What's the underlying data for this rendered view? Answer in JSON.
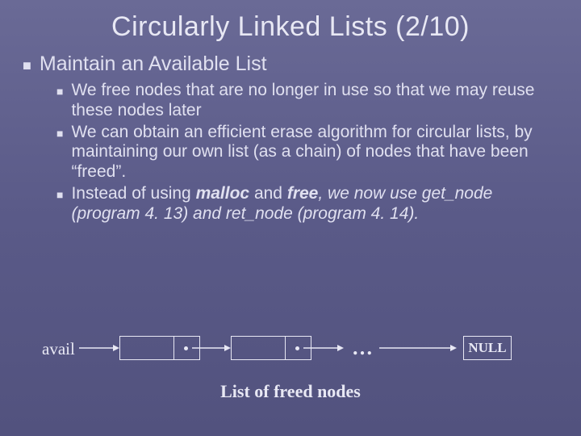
{
  "title": "Circularly Linked Lists (2/10)",
  "heading": "Maintain an Available List",
  "bullets": [
    "We free nodes that are no longer in use so that we may reuse these nodes later",
    "We can obtain an efficient erase algorithm for circular lists, by maintaining our own list (as a chain) of nodes that have been “freed”.",
    {
      "pre": "Instead of using ",
      "m": "malloc",
      "mid": " and ",
      "f": "free",
      "post": ", we now use get_node (program 4. 13) and ret_node (program 4. 14)."
    }
  ],
  "diagram": {
    "avail": "avail",
    "ellipsis": "…",
    "null": "NULL",
    "caption": "List of freed nodes"
  }
}
